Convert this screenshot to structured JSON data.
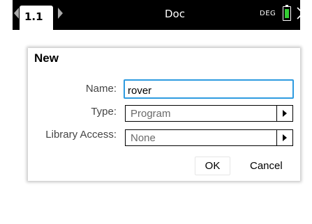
{
  "topbar": {
    "tab_label": "1.1",
    "document_title": "Doc",
    "angle_mode": "DEG",
    "battery_level": 0.9,
    "battery_color": "#33cc33",
    "left_arrow_icon": "chevron-left-icon",
    "right_arrow_icon": "chevron-right-icon",
    "close_icon": "close-icon"
  },
  "dialog": {
    "title": "New",
    "name_label": "Name:",
    "name_value": "rover",
    "type_label": "Type:",
    "type_value": "Program",
    "library_label": "Library Access:",
    "library_value": "None",
    "ok_label": "OK",
    "cancel_label": "Cancel",
    "focus_color": "#2e9be0"
  }
}
